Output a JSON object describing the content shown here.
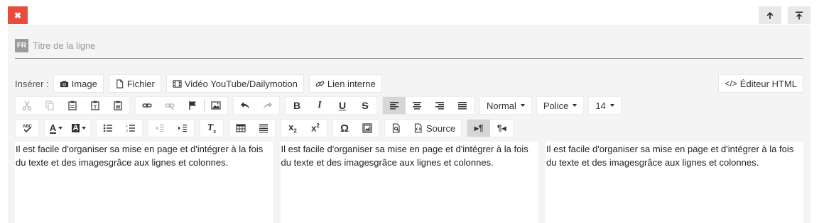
{
  "title_field": {
    "lang": "FR",
    "placeholder": "Titre de la ligne",
    "value": ""
  },
  "insert": {
    "label": "Insérer :",
    "buttons": [
      {
        "label": "Image",
        "icon": "camera-icon"
      },
      {
        "label": "Fichier",
        "icon": "file-icon"
      },
      {
        "label": "Vidéo YouTube/Dailymotion",
        "icon": "film-icon"
      },
      {
        "label": "Lien interne",
        "icon": "link-icon"
      }
    ],
    "html_editor": {
      "label": "Éditeur HTML",
      "icon": "code-icon"
    }
  },
  "toolbar": {
    "format_dropdown": "Normal",
    "font_dropdown": "Police",
    "size_dropdown": "14",
    "source_label": "Source",
    "icons_row1": [
      "cut-icon",
      "copy-icon",
      "paste-icon",
      "paste-text-icon",
      "paste-word-icon",
      "link-icon",
      "unlink-icon",
      "anchor-flag-icon",
      "image-icon",
      "undo-icon",
      "redo-icon",
      "bold-icon",
      "italic-icon",
      "underline-icon",
      "strikethrough-icon",
      "align-left-icon",
      "align-center-icon",
      "align-right-icon",
      "align-justify-icon"
    ],
    "icons_row2": [
      "spellcheck-icon",
      "text-color-icon",
      "background-color-icon",
      "bulleted-list-icon",
      "numbered-list-icon",
      "outdent-icon",
      "indent-icon",
      "remove-format-icon",
      "table-icon",
      "horizontal-rule-icon",
      "subscript-icon",
      "superscript-icon",
      "special-char-icon",
      "iframe-icon",
      "preview-icon",
      "source-icon",
      "ltr-icon",
      "rtl-icon"
    ]
  },
  "columns": [
    {
      "text": "Il est facile d'organiser sa mise en page et d'intégrer à la fois du texte et des imagesgrâce aux lignes et colonnes."
    },
    {
      "text": "Il est facile d'organiser sa mise en page et d'intégrer à la fois du texte et des imagesgrâce aux lignes et colonnes."
    },
    {
      "text": "Il est facile d'organiser sa mise en page et d'intégrer à la fois du texte et des imagesgrâce aux lignes et colonnes."
    }
  ],
  "colors": {
    "delete": "#e74c3c",
    "panel": "#f4f4f4",
    "active": "#d6d6d6"
  }
}
